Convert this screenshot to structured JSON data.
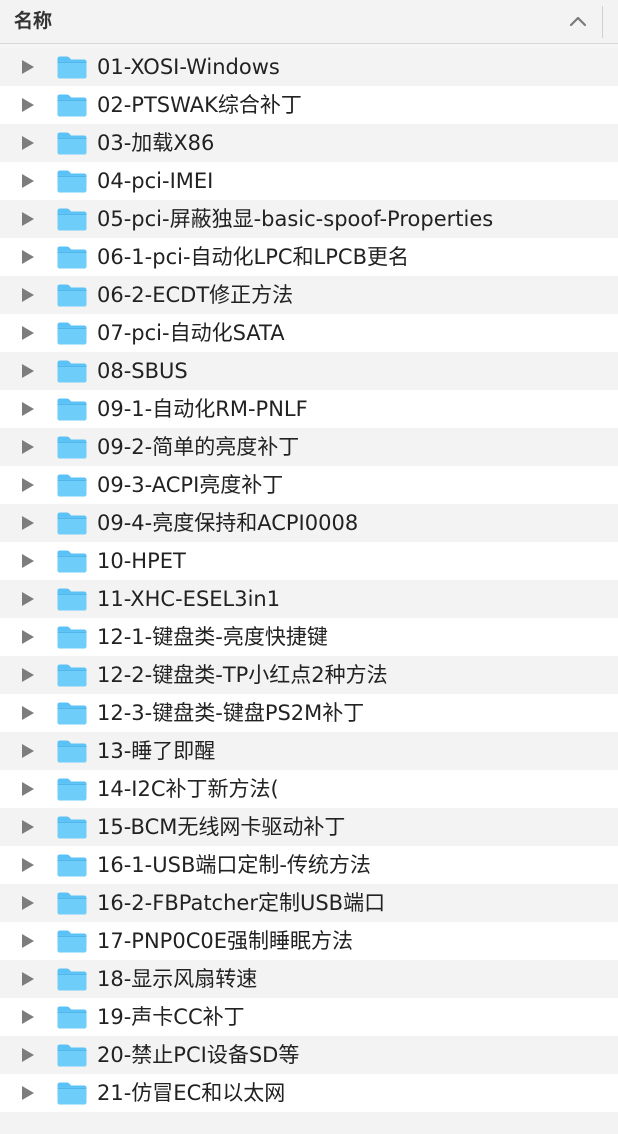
{
  "header": {
    "column_title": "名称",
    "sort_icon": "chevron-up-icon"
  },
  "icons": {
    "disclosure": "disclosure-triangle-icon",
    "folder": "folder-icon",
    "folder_color": "#5ac2f7"
  },
  "items": [
    {
      "label": "01-XOSI-Windows"
    },
    {
      "label": "02-PTSWAK综合补丁"
    },
    {
      "label": "03-加载X86"
    },
    {
      "label": "04-pci-IMEI"
    },
    {
      "label": "05-pci-屏蔽独显-basic-spoof-Properties"
    },
    {
      "label": "06-1-pci-自动化LPC和LPCB更名"
    },
    {
      "label": "06-2-ECDT修正方法"
    },
    {
      "label": "07-pci-自动化SATA"
    },
    {
      "label": "08-SBUS"
    },
    {
      "label": "09-1-自动化RM-PNLF"
    },
    {
      "label": "09-2-简单的亮度补丁"
    },
    {
      "label": "09-3-ACPI亮度补丁"
    },
    {
      "label": "09-4-亮度保持和ACPI0008"
    },
    {
      "label": "10-HPET"
    },
    {
      "label": "11-XHC-ESEL3in1"
    },
    {
      "label": "12-1-键盘类-亮度快捷键"
    },
    {
      "label": "12-2-键盘类-TP小红点2种方法"
    },
    {
      "label": "12-3-键盘类-键盘PS2M补丁"
    },
    {
      "label": "13-睡了即醒"
    },
    {
      "label": "14-I2C补丁新方法("
    },
    {
      "label": "15-BCM无线网卡驱动补丁"
    },
    {
      "label": "16-1-USB端口定制-传统方法"
    },
    {
      "label": "16-2-FBPatcher定制USB端口"
    },
    {
      "label": "17-PNP0C0E强制睡眠方法"
    },
    {
      "label": "18-显示风扇转速"
    },
    {
      "label": "19-声卡CC补丁"
    },
    {
      "label": "20-禁止PCI设备SD等"
    },
    {
      "label": "21-仿冒EC和以太网"
    }
  ]
}
